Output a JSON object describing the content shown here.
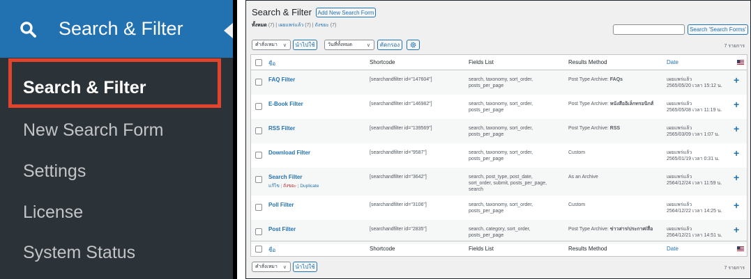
{
  "left_menu": {
    "header_label": "Search & Filter",
    "header_icon": "magnifier-icon",
    "items": [
      {
        "label": "Search & Filter",
        "current": true
      },
      {
        "label": "New Search Form",
        "current": false
      },
      {
        "label": "Settings",
        "current": false
      },
      {
        "label": "License",
        "current": false
      },
      {
        "label": "System Status",
        "current": false
      }
    ],
    "highlight_color": "#e1432d",
    "header_color": "#2271b1"
  },
  "page": {
    "title": "Search & Filter",
    "add_new_label": "Add New Search Form",
    "views": {
      "all": "ทั้งหมด",
      "all_count": "(7)",
      "published": "เผยแพร่แล้ว",
      "published_count": "(7)",
      "trash": "ถังขยะ",
      "trash_count": "(7)",
      "sep": "|"
    },
    "search_input_value": "",
    "search_button_label": "Search 'Search Forms'",
    "bulk_action_label": "คำสั่งเหมา",
    "apply_label": "นำไปใช้",
    "date_filter_label": "วันที่ทั้งหมด",
    "filter_label": "คัดกรอง",
    "item_count": "7 รายการ"
  },
  "table": {
    "columns": {
      "title": "ชื่อ",
      "shortcode": "Shortcode",
      "fields": "Fields List",
      "results": "Results Method",
      "date": "Date"
    },
    "rows": [
      {
        "title": "FAQ Filter",
        "shortcode": "[searchandfilter id=\"147604\"]",
        "fields1": "search, taxonomy, sort_order,",
        "fields2": "posts_per_page",
        "fields3": "",
        "results_prefix": "Post Type Archive: ",
        "results_bold": "FAQs",
        "status": "เผยแพร่แล้ว",
        "date": "2565/05/20 เวลา 15:12 น."
      },
      {
        "title": "E-Book Filter",
        "shortcode": "[searchandfilter id=\"146982\"]",
        "fields1": "search, taxonomy, sort_order,",
        "fields2": "posts_per_page",
        "fields3": "",
        "results_prefix": "Post Type Archive: ",
        "results_bold": "หนังสืออิเล็กทรอนิกส์",
        "status": "เผยแพร่แล้ว",
        "date": "2565/05/08 เวลา 11:19 น."
      },
      {
        "title": "RSS Filter",
        "shortcode": "[searchandfilter id=\"139569\"]",
        "fields1": "search, taxonomy, sort_order,",
        "fields2": "posts_per_page",
        "fields3": "",
        "results_prefix": "Post Type Archive: ",
        "results_bold": "RSS",
        "status": "เผยแพร่แล้ว",
        "date": "2565/03/09 เวลา 1:07 น."
      },
      {
        "title": "Download Filter",
        "shortcode": "[searchandfilter id=\"9587\"]",
        "fields1": "search, taxonomy, sort_order,",
        "fields2": "posts_per_page",
        "fields3": "",
        "results_prefix": "Custom",
        "results_bold": "",
        "status": "เผยแพร่แล้ว",
        "date": "2565/01/19 เวลา 0:31 น."
      },
      {
        "title": "Search Filter",
        "shortcode": "[searchandfilter id=\"3642\"]",
        "fields1": "search, post_type, post_date,",
        "fields2": "sort_order, submit, posts_per_page,",
        "fields3": "search",
        "results_prefix": "As an Archive",
        "results_bold": "",
        "status": "เผยแพร่แล้ว",
        "date": "2564/12/24 เวลา 11:59 น.",
        "row_actions": {
          "edit": "แก้ไข",
          "trash": "ถังขยะ",
          "duplicate": "Duplicate",
          "sep": "|"
        }
      },
      {
        "title": "Poll Filter",
        "shortcode": "[searchandfilter id=\"3106\"]",
        "fields1": "search, taxonomy, sort_order,",
        "fields2": "posts_per_page",
        "fields3": "",
        "results_prefix": "Custom",
        "results_bold": "",
        "status": "เผยแพร่แล้ว",
        "date": "2564/12/22 เวลา 14:25 น."
      },
      {
        "title": "Post Filter",
        "shortcode": "[searchandfilter id=\"2835\"]",
        "fields1": "search, category, sort_order,",
        "fields2": "posts_per_page",
        "fields3": "",
        "results_prefix": "Post Type Archive: ",
        "results_bold": "ข่าวสาร/ประกาศ/สื่อ",
        "status": "เผยแพร่แล้ว",
        "date": "2564/12/21 เวลา 14:51 น."
      }
    ],
    "row_plus_glyph": "+",
    "link_color": "#2271b1"
  },
  "footer": {
    "bulk_action_label": "คำสั่งเหมา",
    "apply_label": "นำไปใช้",
    "item_count": "7 รายการ"
  }
}
